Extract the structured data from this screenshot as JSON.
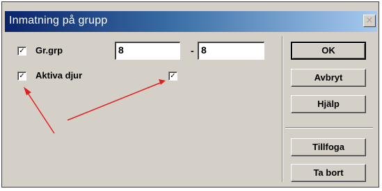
{
  "dialog": {
    "title": "Inmatning på grupp",
    "close_glyph": "×"
  },
  "fields": {
    "grgrp": {
      "checked": true,
      "label": "Gr.grp",
      "from_value": "8",
      "separator": "-",
      "to_value": "8"
    },
    "aktiva": {
      "checked": true,
      "label": "Aktiva djur",
      "second_checked": true
    }
  },
  "buttons": {
    "ok": "OK",
    "cancel": "Avbryt",
    "help": "Hjälp",
    "add": "Tillfoga",
    "remove": "Ta bort"
  },
  "annotation": {
    "arrow_color": "#e02020"
  },
  "colors": {
    "dialog_face": "#d4d0c8",
    "titlebar_start": "#0a246a",
    "titlebar_end": "#a6caf0"
  }
}
